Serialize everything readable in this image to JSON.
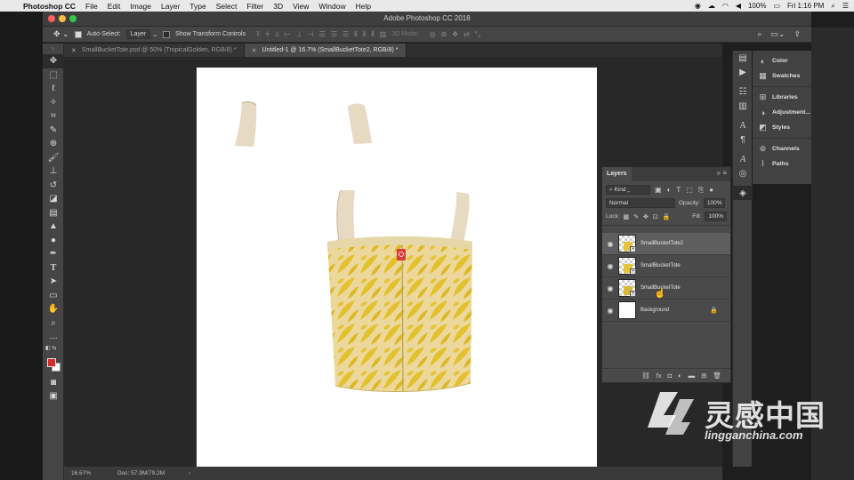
{
  "menubar": {
    "app": "Photoshop CC",
    "items": [
      "File",
      "Edit",
      "Image",
      "Layer",
      "Type",
      "Select",
      "Filter",
      "3D",
      "View",
      "Window",
      "Help"
    ],
    "battery": "100%",
    "clock": "Fri 1:16 PM"
  },
  "window": {
    "title": "Adobe Photoshop CC 2018"
  },
  "options": {
    "auto_select_label": "Auto-Select:",
    "auto_select_target": "Layer",
    "transform_label": "Show Transform Controls",
    "mode_3d": "3D Mode:"
  },
  "tabs": [
    {
      "label": "SmallBucketTote.psd @ 50% (TropicalGolden, RGB/8) *",
      "active": false
    },
    {
      "label": "Untitled-1 @ 16.7% (SmallBucketTote2, RGB/8) *",
      "active": true
    }
  ],
  "status": {
    "zoom": "16.67%",
    "doc": "Doc: 57.9M/79.2M",
    "arrow": "›"
  },
  "panels": {
    "groups": [
      [
        {
          "label": "Color",
          "icon": "color-wheel-icon"
        },
        {
          "label": "Swatches",
          "icon": "swatches-grid-icon"
        }
      ],
      [
        {
          "label": "Libraries",
          "icon": "libraries-icon"
        },
        {
          "label": "Adjustment...",
          "icon": "adjustments-icon"
        },
        {
          "label": "Styles",
          "icon": "styles-icon"
        }
      ],
      [
        {
          "label": "Channels",
          "icon": "channels-icon"
        },
        {
          "label": "Paths",
          "icon": "paths-icon"
        }
      ]
    ]
  },
  "layers": {
    "title": "Layers",
    "filter_kind": "Kind",
    "blend_mode": "Normal",
    "opacity_label": "Opacity:",
    "opacity_value": "100%",
    "lock_label": "Lock:",
    "fill_label": "Fill:",
    "fill_value": "100%",
    "items": [
      {
        "name": "SmallBucketTote2",
        "selected": true
      },
      {
        "name": "SmallBucketTote",
        "selected": false
      },
      {
        "name": "SmallBucketTote",
        "selected": false
      },
      {
        "name": "Background",
        "selected": false
      }
    ]
  },
  "watermark": {
    "brand": "灵感中国",
    "url": "lingganchina.com"
  },
  "colors": {
    "foreground": "#d42a2a",
    "background": "#ffffff",
    "tote_yellow": "#e6c53a",
    "strap": "#e9dcc4",
    "tag_red": "#d93a3a"
  }
}
